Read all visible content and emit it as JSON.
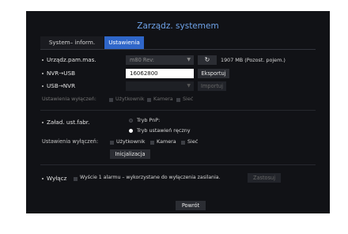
{
  "title": "Zarządz. systemem",
  "tabs": [
    {
      "label": "System– inform."
    },
    {
      "label": "Ustawienia"
    }
  ],
  "device": {
    "label": "Urządz.pam.mas.",
    "select_value": "m80 Rev:",
    "refresh_icon": "refresh-icon",
    "free_space": "1907 MB  (Pozost. pojem.)"
  },
  "nvr_usb": {
    "label": "NVR→USB",
    "value": "16062800",
    "button": "Eksportuj"
  },
  "usb_nvr": {
    "label": "USB→NVR",
    "select_value": "",
    "button": "Importuj"
  },
  "exclude_row1": {
    "label": "Ustawienia wyłączeń:",
    "options": [
      "Użytkownik",
      "Kamera",
      "Sieć"
    ]
  },
  "factory": {
    "label": "Załad. ust.fabr.",
    "radio_pnp": "Tryb PnP:",
    "radio_manual": "Tryb ustawień ręczny",
    "selected": "Tryb ustawień ręczny"
  },
  "exclude_row2": {
    "label": "Ustawienia wyłączeń:",
    "options": [
      "Użytkownik",
      "Kamera",
      "Sieć"
    ]
  },
  "init_button": "Inicjalizacja",
  "shutdown": {
    "label": "Wyłącz",
    "option": "Wyście 1 alarmu – wykorzystane do wyłączenia zasilania.",
    "apply_button": "Zastosuj"
  },
  "back_button": "Powrót",
  "colors": {
    "accent": "#2f66c9",
    "title": "#6ea2e8",
    "panel_bg": "#111216"
  }
}
